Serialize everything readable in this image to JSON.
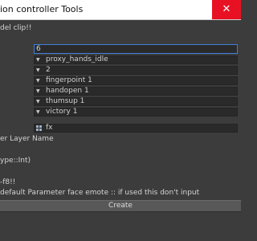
{
  "window": {
    "title": "ion controller Tools",
    "close_glyph": "✕"
  },
  "header_text": "del clip!!",
  "number_field": {
    "value": "6"
  },
  "clip_fields": [
    {
      "label": "proxy_hands_idle",
      "icon": "triangle-icon"
    },
    {
      "label": "2",
      "icon": "triangle-icon"
    },
    {
      "label": "fingerpoint 1",
      "icon": "triangle-icon"
    },
    {
      "label": "handopen 1",
      "icon": "triangle-icon"
    },
    {
      "label": "thumsup 1",
      "icon": "triangle-icon"
    },
    {
      "label": "victory 1",
      "icon": "triangle-icon"
    }
  ],
  "controller_field": {
    "label": "fx",
    "icon": "grid-icon"
  },
  "layer_name_label": "er Layer Name",
  "type_label": "ype::Int)",
  "warning_text": "-f8!!",
  "param_note": "default Parameter face emote :: if used this don't input",
  "create_button": {
    "label": "Create"
  },
  "colors": {
    "background": "#3c3c3c",
    "field": "#2a2a2a",
    "focus_border": "#3f7fd9",
    "close": "#e81123",
    "button": "#585858"
  }
}
